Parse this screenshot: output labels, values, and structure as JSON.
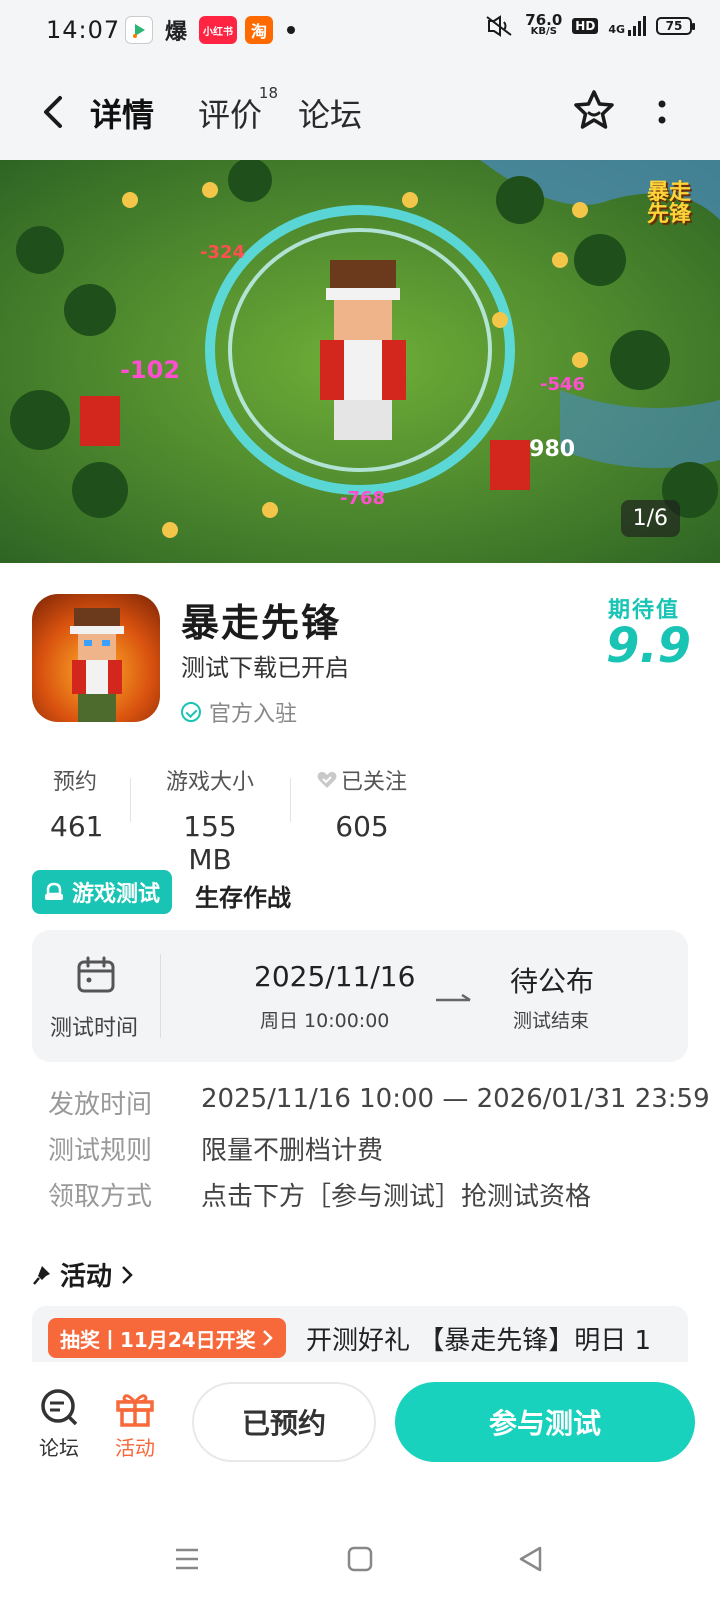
{
  "status_bar": {
    "time": "14:07",
    "app_icons": [
      {
        "name": "video-app-icon",
        "label": "",
        "color": "#ffffff"
      },
      {
        "name": "bao-app-icon",
        "label": "爆",
        "color": "#222222"
      },
      {
        "name": "xiaohongshu-icon",
        "label": "小红书",
        "color": "#ff2442"
      },
      {
        "name": "taobao-icon",
        "label": "淘",
        "color": "#ff6a00"
      }
    ],
    "net_speed": "76.0",
    "net_unit": "KB/S",
    "hd": "HD",
    "signal": "4G",
    "battery": "75"
  },
  "nav": {
    "tabs": [
      {
        "label": "详情"
      },
      {
        "label": "评价",
        "badge": "18"
      },
      {
        "label": "论坛"
      }
    ]
  },
  "hero": {
    "counter": "1/6",
    "logo_text": "暴走先锋"
  },
  "game": {
    "name": "暴走先锋",
    "subtitle": "测试下载已开启",
    "official": "官方入驻",
    "expect_label": "期待值",
    "expect_value": "9.9"
  },
  "stats": [
    {
      "label": "预约",
      "value": "461"
    },
    {
      "label": "游戏大小",
      "value": "155 MB"
    },
    {
      "label": "已关注",
      "value": "605"
    }
  ],
  "test": {
    "tag": "游戏测试",
    "name": "生存作战",
    "time_label": "测试时间",
    "start_date": "2025/11/16",
    "start_sub": "周日 10:00:00",
    "end": "待公布",
    "end_sub": "测试结束"
  },
  "info": [
    {
      "key": "发放时间",
      "value": "2025/11/16 10:00 — 2026/01/31 23:59"
    },
    {
      "key": "测试规则",
      "value": "限量不删档计费"
    },
    {
      "key": "领取方式",
      "value": "点击下方［参与测试］抢测试资格"
    }
  ],
  "activity": {
    "title": "活动",
    "badge": "抽奖丨11月24日开奖",
    "text": "开测好礼 【暴走先锋】明日 1"
  },
  "bottom": {
    "forum": "论坛",
    "activity": "活动",
    "reserved": "已预约",
    "join": "参与测试"
  },
  "colors": {
    "accent": "#19c4b5",
    "join_button": "#19d2bd",
    "orange": "#f7683a"
  }
}
